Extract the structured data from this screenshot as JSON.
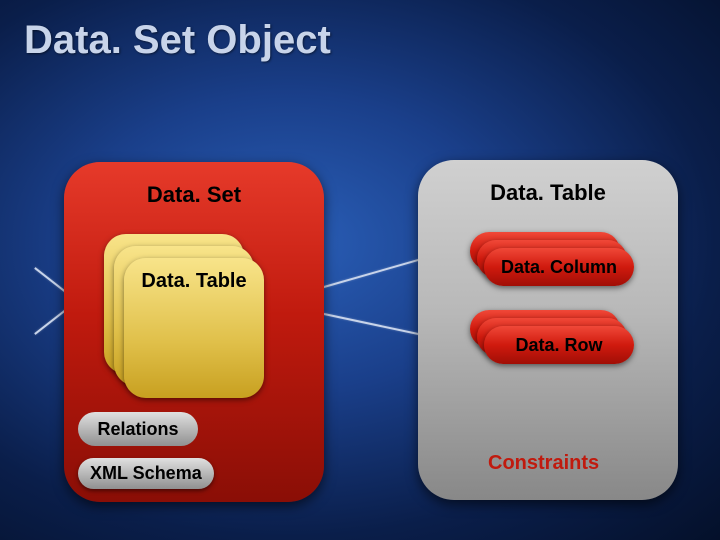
{
  "title": "Data. Set Object",
  "left_panel": {
    "header": "Data. Set",
    "stack_label": "Data. Table",
    "relations_label": "Relations",
    "xml_label": "XML Schema"
  },
  "right_panel": {
    "header": "Data. Table",
    "column_label": "Data. Column",
    "row_label": "Data. Row",
    "constraints_label": "Constraints"
  }
}
